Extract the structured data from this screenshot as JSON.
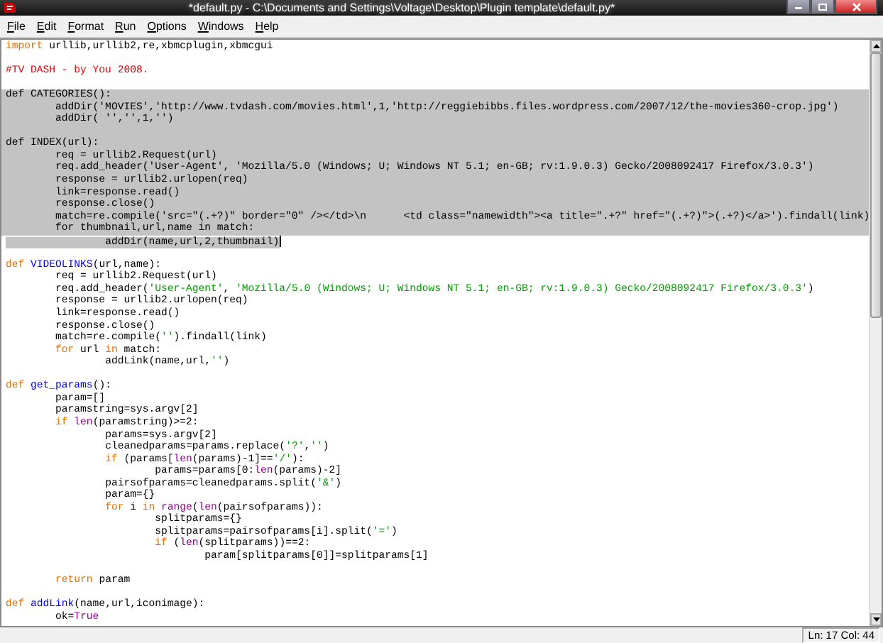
{
  "window": {
    "title": "*default.py - C:\\Documents and Settings\\Voltage\\Desktop\\Plugin template\\default.py*"
  },
  "menu": [
    "File",
    "Edit",
    "Format",
    "Run",
    "Options",
    "Windows",
    "Help"
  ],
  "editor": {
    "lines": [
      {
        "selected": false,
        "tokens": [
          {
            "kind": "keyword",
            "text": "import"
          },
          {
            "kind": "plain",
            "text": " urllib,urllib2,re,xbmcplugin,xbmcgui"
          }
        ]
      },
      {
        "selected": false
      },
      {
        "selected": false,
        "tokens": [
          {
            "kind": "comment",
            "text": "#TV DASH - by You 2008."
          }
        ]
      },
      {
        "selected": false
      },
      {
        "selected": true,
        "text": "def CATEGORIES():"
      },
      {
        "selected": true,
        "text": "\taddDir('MOVIES','http://www.tvdash.com/movies.html',1,'http://reggiebibbs.files.wordpress.com/2007/12/the-movies360-crop.jpg')"
      },
      {
        "selected": true,
        "text": "\taddDir( '','',1,'')"
      },
      {
        "selected": true
      },
      {
        "selected": true,
        "text": "def INDEX(url):"
      },
      {
        "selected": true,
        "text": "\treq = urllib2.Request(url)"
      },
      {
        "selected": true,
        "text": "\treq.add_header('User-Agent', 'Mozilla/5.0 (Windows; U; Windows NT 5.1; en-GB; rv:1.9.0.3) Gecko/2008092417 Firefox/3.0.3')"
      },
      {
        "selected": true,
        "text": "\tresponse = urllib2.urlopen(req)"
      },
      {
        "selected": true,
        "text": "\tlink=response.read()"
      },
      {
        "selected": true,
        "text": "\tresponse.close()"
      },
      {
        "selected": true,
        "text": "\tmatch=re.compile('src=\"(.+?)\" border=\"0\" /></td>\\n\t<td class=\"namewidth\"><a title=\".+?\" href=\"(.+?)\">(.+?)</a>').findall(link)"
      },
      {
        "selected": true,
        "text": "\tfor thumbnail,url,name in match:"
      },
      {
        "selected": true,
        "text": "\t\taddDir(name,url,2,thumbnail)"
      },
      {
        "selected": false
      },
      {
        "selected": false,
        "tokens": [
          {
            "kind": "keyword",
            "text": "def"
          },
          {
            "kind": "definition",
            "text": " VIDEOLINKS"
          },
          {
            "kind": "plain",
            "text": "(url,name):"
          }
        ]
      },
      {
        "selected": false,
        "tokens": [
          {
            "kind": "plain",
            "text": "\treq = urllib2.Request(url)"
          }
        ]
      },
      {
        "selected": false,
        "tokens": [
          {
            "kind": "plain",
            "text": "\treq.add_header("
          },
          {
            "kind": "string",
            "text": "'User-Agent'"
          },
          {
            "kind": "plain",
            "text": ", "
          },
          {
            "kind": "string",
            "text": "'Mozilla/5.0 (Windows; U; Windows NT 5.1; en-GB; rv:1.9.0.3) Gecko/2008092417 Firefox/3.0.3'"
          },
          {
            "kind": "plain",
            "text": ")"
          }
        ]
      },
      {
        "selected": false,
        "tokens": [
          {
            "kind": "plain",
            "text": "\tresponse = urllib2.urlopen(req)"
          }
        ]
      },
      {
        "selected": false,
        "tokens": [
          {
            "kind": "plain",
            "text": "\tlink=response.read()"
          }
        ]
      },
      {
        "selected": false,
        "tokens": [
          {
            "kind": "plain",
            "text": "\tresponse.close()"
          }
        ]
      },
      {
        "selected": false,
        "tokens": [
          {
            "kind": "plain",
            "text": "\tmatch=re.compile("
          },
          {
            "kind": "string",
            "text": "''"
          },
          {
            "kind": "plain",
            "text": ").findall(link)"
          }
        ]
      },
      {
        "selected": false,
        "tokens": [
          {
            "kind": "keyword",
            "text": "\tfor"
          },
          {
            "kind": "plain",
            "text": " url "
          },
          {
            "kind": "keyword",
            "text": "in"
          },
          {
            "kind": "plain",
            "text": " match:"
          }
        ]
      },
      {
        "selected": false,
        "tokens": [
          {
            "kind": "plain",
            "text": "\t\taddLink(name,url,"
          },
          {
            "kind": "string",
            "text": "''"
          },
          {
            "kind": "plain",
            "text": ")"
          }
        ]
      },
      {
        "selected": false
      },
      {
        "selected": false,
        "tokens": [
          {
            "kind": "keyword",
            "text": "def"
          },
          {
            "kind": "definition",
            "text": " get_params"
          },
          {
            "kind": "plain",
            "text": "():"
          }
        ]
      },
      {
        "selected": false,
        "tokens": [
          {
            "kind": "plain",
            "text": "\tparam=[]"
          }
        ]
      },
      {
        "selected": false,
        "tokens": [
          {
            "kind": "plain",
            "text": "\tparamstring=sys.argv[2]"
          }
        ]
      },
      {
        "selected": false,
        "tokens": [
          {
            "kind": "keyword",
            "text": "\tif"
          },
          {
            "kind": "builtin",
            "text": " len"
          },
          {
            "kind": "plain",
            "text": "(paramstring)>=2:"
          }
        ]
      },
      {
        "selected": false,
        "tokens": [
          {
            "kind": "plain",
            "text": "\t\tparams=sys.argv[2]"
          }
        ]
      },
      {
        "selected": false,
        "tokens": [
          {
            "kind": "plain",
            "text": "\t\tcleanedparams=params.replace("
          },
          {
            "kind": "string",
            "text": "'?'"
          },
          {
            "kind": "plain",
            "text": ","
          },
          {
            "kind": "string",
            "text": "''"
          },
          {
            "kind": "plain",
            "text": ")"
          }
        ]
      },
      {
        "selected": false,
        "tokens": [
          {
            "kind": "keyword",
            "text": "\t\tif"
          },
          {
            "kind": "plain",
            "text": " (params["
          },
          {
            "kind": "builtin",
            "text": "len"
          },
          {
            "kind": "plain",
            "text": "(params)-1]=="
          },
          {
            "kind": "string",
            "text": "'/'"
          },
          {
            "kind": "plain",
            "text": "):"
          }
        ]
      },
      {
        "selected": false,
        "tokens": [
          {
            "kind": "plain",
            "text": "\t\t\tparams=params[0:"
          },
          {
            "kind": "builtin",
            "text": "len"
          },
          {
            "kind": "plain",
            "text": "(params)-2]"
          }
        ]
      },
      {
        "selected": false,
        "tokens": [
          {
            "kind": "plain",
            "text": "\t\tpairsofparams=cleanedparams.split("
          },
          {
            "kind": "string",
            "text": "'&'"
          },
          {
            "kind": "plain",
            "text": ")"
          }
        ]
      },
      {
        "selected": false,
        "tokens": [
          {
            "kind": "plain",
            "text": "\t\tparam={}"
          }
        ]
      },
      {
        "selected": false,
        "tokens": [
          {
            "kind": "keyword",
            "text": "\t\tfor"
          },
          {
            "kind": "plain",
            "text": " i "
          },
          {
            "kind": "keyword",
            "text": "in"
          },
          {
            "kind": "builtin",
            "text": " range"
          },
          {
            "kind": "plain",
            "text": "("
          },
          {
            "kind": "builtin",
            "text": "len"
          },
          {
            "kind": "plain",
            "text": "(pairsofparams)):"
          }
        ]
      },
      {
        "selected": false,
        "tokens": [
          {
            "kind": "plain",
            "text": "\t\t\tsplitparams={}"
          }
        ]
      },
      {
        "selected": false,
        "tokens": [
          {
            "kind": "plain",
            "text": "\t\t\tsplitparams=pairsofparams[i].split("
          },
          {
            "kind": "string",
            "text": "'='"
          },
          {
            "kind": "plain",
            "text": ")"
          }
        ]
      },
      {
        "selected": false,
        "tokens": [
          {
            "kind": "keyword",
            "text": "\t\t\tif"
          },
          {
            "kind": "plain",
            "text": " ("
          },
          {
            "kind": "builtin",
            "text": "len"
          },
          {
            "kind": "plain",
            "text": "(splitparams))==2:"
          }
        ]
      },
      {
        "selected": false,
        "tokens": [
          {
            "kind": "plain",
            "text": "\t\t\t\tparam[splitparams[0]]=splitparams[1]"
          }
        ]
      },
      {
        "selected": false
      },
      {
        "selected": false,
        "tokens": [
          {
            "kind": "keyword",
            "text": "\treturn"
          },
          {
            "kind": "plain",
            "text": " param"
          }
        ]
      },
      {
        "selected": false
      },
      {
        "selected": false,
        "tokens": [
          {
            "kind": "keyword",
            "text": "def"
          },
          {
            "kind": "definition",
            "text": " addLink"
          },
          {
            "kind": "plain",
            "text": "(name,url,iconimage):"
          }
        ]
      },
      {
        "selected": false,
        "tokens": [
          {
            "kind": "plain",
            "text": "\tok="
          },
          {
            "kind": "builtin",
            "text": "True"
          }
        ]
      }
    ]
  },
  "status_bar": {
    "position": "Ln: 17 Col: 44"
  }
}
